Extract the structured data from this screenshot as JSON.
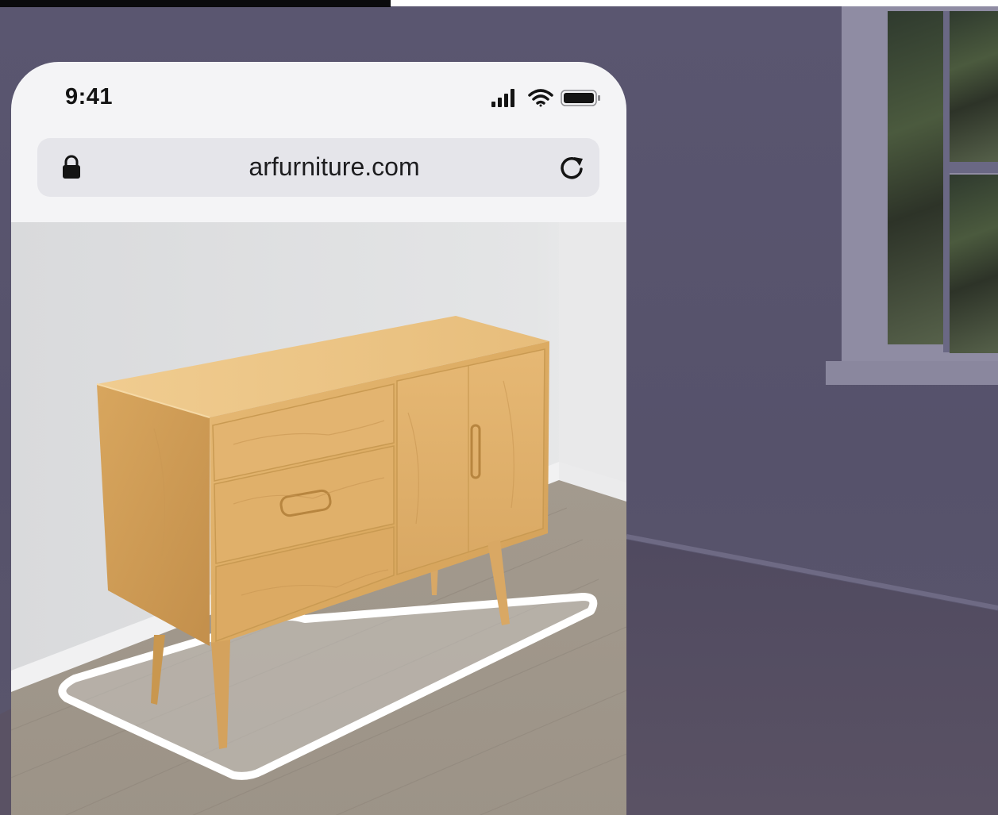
{
  "status_bar": {
    "time": "9:41",
    "signal_icon": "cellular-signal-icon",
    "wifi_icon": "wifi-icon",
    "battery_icon": "battery-icon"
  },
  "browser": {
    "url": "arfurniture.com",
    "lock_icon": "lock-icon",
    "reload_icon": "reload-icon"
  },
  "scene": {
    "object": "wooden-sideboard",
    "placement_marker": "ar-placement-outline"
  },
  "colors": {
    "wall_background": "#57536c",
    "phone_chrome": "#f4f4f6",
    "url_bar": "#e5e5ea",
    "wood": "#e0b36a",
    "ar_outline": "#ffffff"
  }
}
